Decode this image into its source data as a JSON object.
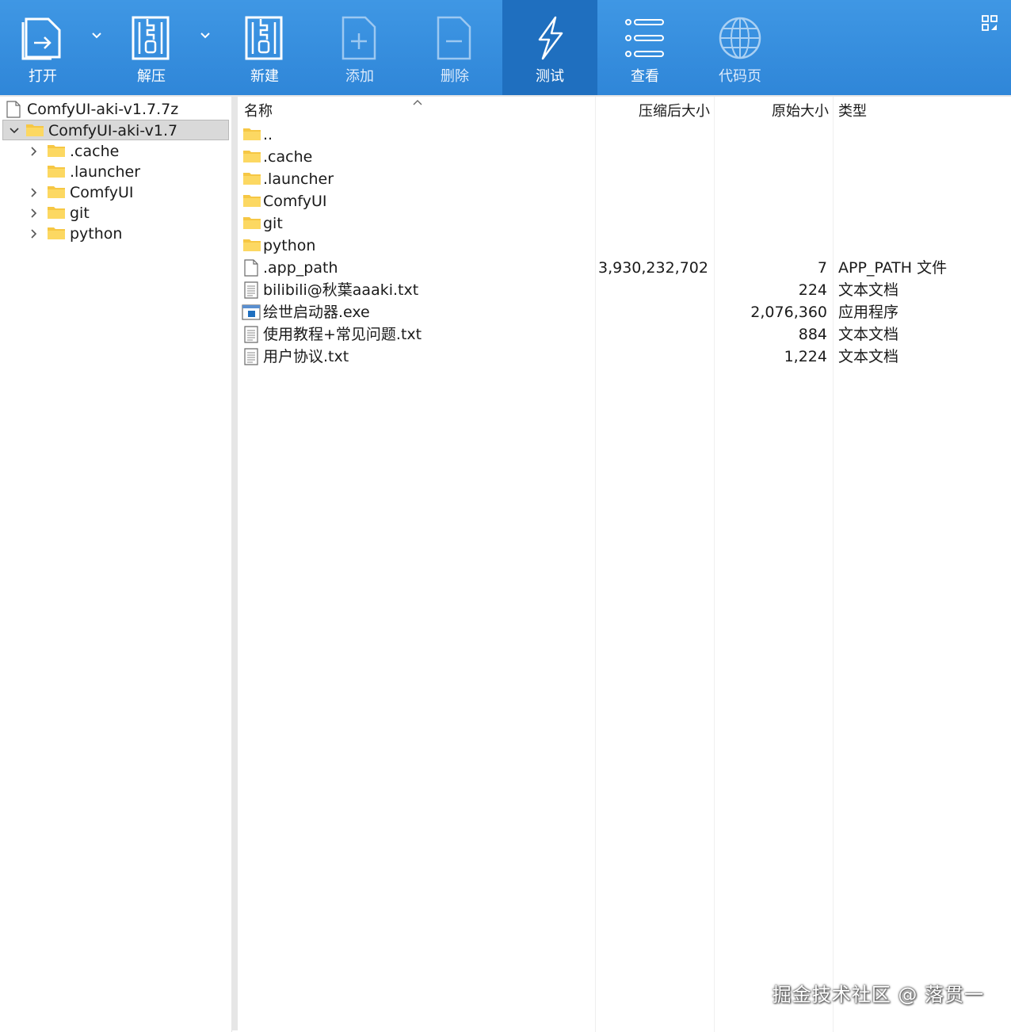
{
  "toolbar": {
    "open": "打开",
    "extract": "解压",
    "new": "新建",
    "add": "添加",
    "delete": "删除",
    "test": "测试",
    "view": "查看",
    "codepage": "代码页"
  },
  "tree": {
    "archive": "ComfyUI-aki-v1.7.7z",
    "root": "ComfyUI-aki-v1.7",
    "children": [
      ".cache",
      ".launcher",
      "ComfyUI",
      "git",
      "python"
    ]
  },
  "list": {
    "headers": {
      "name": "名称",
      "packed": "压缩后大小",
      "size": "原始大小",
      "type": "类型"
    },
    "rows": [
      {
        "name": "..",
        "packed": "",
        "size": "",
        "type": ""
      },
      {
        "name": ".cache",
        "packed": "",
        "size": "",
        "type": ""
      },
      {
        "name": ".launcher",
        "packed": "",
        "size": "",
        "type": ""
      },
      {
        "name": "ComfyUI",
        "packed": "",
        "size": "",
        "type": ""
      },
      {
        "name": "git",
        "packed": "",
        "size": "",
        "type": ""
      },
      {
        "name": "python",
        "packed": "",
        "size": "",
        "type": ""
      },
      {
        "name": ".app_path",
        "packed": "3,930,232,702",
        "size": "7",
        "type": "APP_PATH 文件"
      },
      {
        "name": "bilibili@秋葉aaaki.txt",
        "packed": "",
        "size": "224",
        "type": "文本文档"
      },
      {
        "name": "绘世启动器.exe",
        "packed": "",
        "size": "2,076,360",
        "type": "应用程序"
      },
      {
        "name": "使用教程+常见问题.txt",
        "packed": "",
        "size": "884",
        "type": "文本文档"
      },
      {
        "name": "用户协议.txt",
        "packed": "",
        "size": "1,224",
        "type": "文本文档"
      }
    ]
  },
  "watermark": "掘金技术社区 @ 落贯一",
  "colors": {
    "toolbar": "#3f97e4",
    "active_tool": "#1f6fbf",
    "folder": "#f6c744"
  }
}
